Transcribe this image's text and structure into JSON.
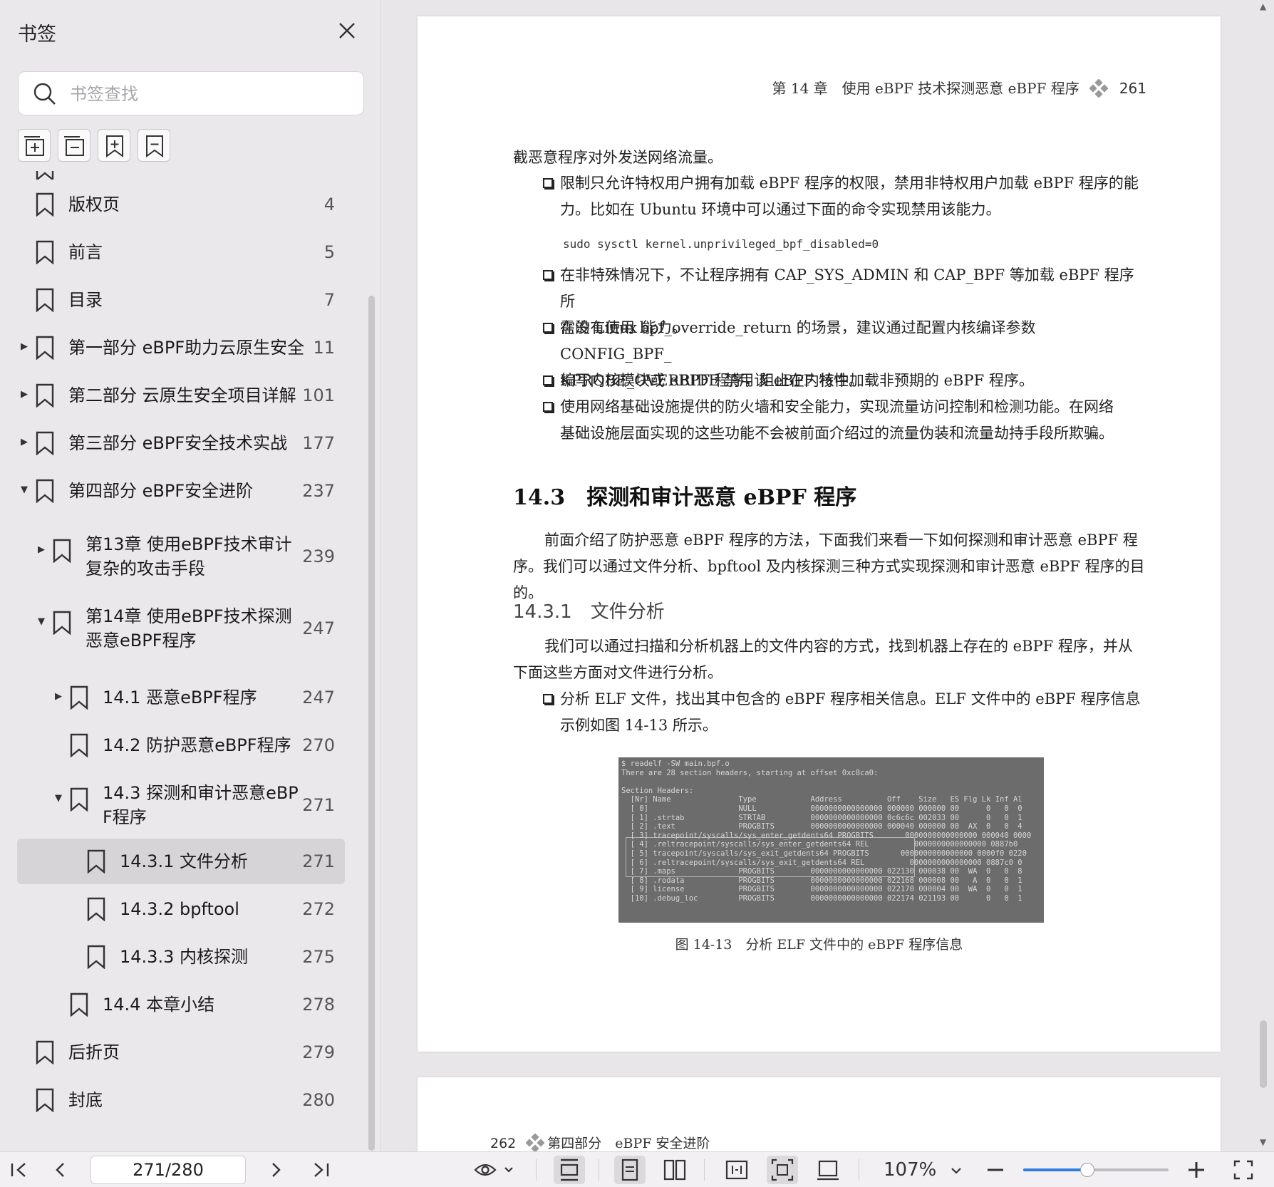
{
  "sidebar": {
    "title": "书签",
    "close_icon": "close-icon",
    "search_placeholder": "书签查找",
    "tools": [
      "expand-all-icon",
      "collapse-all-icon",
      "add-bookmark-icon",
      "remove-bookmark-icon"
    ],
    "items": [
      {
        "label": "版权页",
        "page": "4"
      },
      {
        "label": "前言",
        "page": "5"
      },
      {
        "label": "目录",
        "page": "7"
      },
      {
        "label": "第一部分 eBPF助力云原生安全",
        "page": "11"
      },
      {
        "label": "第二部分 云原生安全项目详解",
        "page": "101"
      },
      {
        "label": "第三部分 eBPF安全技术实战",
        "page": "177"
      },
      {
        "label": "第四部分 eBPF安全进阶",
        "page": "237"
      },
      {
        "label": "第13章 使用eBPF技术审计",
        "label2": "复杂的攻击手段",
        "page": "239"
      },
      {
        "label": "第14章 使用eBPF技术探测",
        "label2": "恶意eBPF程序",
        "page": "247"
      },
      {
        "label": "14.1 恶意eBPF程序",
        "page": "247"
      },
      {
        "label": "14.2 防护恶意eBPF程序",
        "page": "270"
      },
      {
        "label": "14.3 探测和审计恶意eBP",
        "label2": "F程序",
        "page": "271"
      },
      {
        "label": "14.3.1 文件分析",
        "page": "271"
      },
      {
        "label": "14.3.2 bpftool",
        "page": "272"
      },
      {
        "label": "14.3.3 内核探测",
        "page": "275"
      },
      {
        "label": "14.4 本章小结",
        "page": "278"
      },
      {
        "label": "后折页",
        "page": "279"
      },
      {
        "label": "封底",
        "page": "280"
      }
    ]
  },
  "page1": {
    "header_text": "第 14 章　使用 eBPF 技术探测恶意 eBPF 程序",
    "header_page": "261",
    "intro_tail": "截恶意程序对外发送网络流量。",
    "bullet1_l1": "限制只允许特权用户拥有加载 eBPF 程序的权限，禁用非特权用户加载 eBPF 程序的能",
    "bullet1_l2": "力。比如在 Ubuntu 环境中可以通过下面的命令实现禁用该能力。",
    "command": "sudo sysctl kernel.unprivileged_bpf_disabled=0",
    "bullet2_l1": "在非特殊情况下，不让程序拥有 CAP_SYS_ADMIN 和 CAP_BPF 等加载 eBPF 程序所",
    "bullet2_l2": "需的 Linux 能力。",
    "bullet3_l1": "在没有使用 bpf_override_return 的场景，建议通过配置内核编译参数 CONFIG_BPF_",
    "bullet3_l2": "KPROBE_OVERRIDE 禁用该 eBPF 特性。",
    "bullet4_l1": "编写内核模块或 eBPF 程序，阻止在内核中加载非预期的 eBPF 程序。",
    "bullet5_l1": "使用网络基础设施提供的防火墙和安全能力，实现流量访问控制和检测功能。在网络",
    "bullet5_l2": "基础设施层面实现的这些功能不会被前面介绍过的流量伪装和流量劫持手段所欺骗。",
    "section_title": "14.3　探测和审计恶意 eBPF 程序",
    "para1_l1": "前面介绍了防护恶意 eBPF 程序的方法，下面我们来看一下如何探测和审计恶意 eBPF 程",
    "para1_l2": "序。我们可以通过文件分析、bpftool 及内核探测三种方式实现探测和审计恶意 eBPF 程序的目的。",
    "subsection_title": "14.3.1　文件分析",
    "para2_l1": "我们可以通过扫描和分析机器上的文件内容的方式，找到机器上存在的 eBPF 程序，并从",
    "para2_l2": "下面这些方面对文件进行分析。",
    "bullet6_l1": "分析 ELF 文件，找出其中包含的 eBPF 程序相关信息。ELF 文件中的 eBPF 程序信息",
    "bullet6_l2": "示例如图 14-13 所示。",
    "figure_lines": [
      "$ readelf -SW main.bpf.o",
      "There are 28 section headers, starting at offset 0xc8ca0:",
      "",
      "Section Headers:",
      "  [Nr] Name               Type            Address          Off    Size   ES Flg Lk Inf Al",
      "  [ 0]                    NULL            0000000000000000 000000 000000 00      0   0  0",
      "  [ 1] .strtab            STRTAB          0000000000000000 0c6c6c 002033 00      0   0  1",
      "  [ 2] .text              PROGBITS        0000000000000000 000040 000000 00  AX  0   0  4",
      "  [ 3] tracepoint/syscalls/sys_enter_getdents64 PROGBITS       0000000000000000 000040 0000",
      "  [ 4] .reltracepoint/syscalls/sys_enter_getdents64 REL          0000000000000000 0887b0",
      "  [ 5] tracepoint/syscalls/sys_exit_getdents64 PROGBITS       0000000000000000 0000f0 0220",
      "  [ 6] .reltracepoint/syscalls/sys_exit_getdents64 REL          0000000000000000 0887c0 0",
      "  [ 7] .maps              PROGBITS        0000000000000000 022130 000038 00  WA  0   0  8",
      "  [ 8] .rodata            PROGBITS        0000000000000000 022168 000008 00   A  0   0  1",
      "  [ 9] license            PROGBITS        0000000000000000 022170 000004 00  WA  0   0  1",
      "  [10] .debug_loc         PROGBITS        0000000000000000 022174 021193 00      0   0  1"
    ],
    "figure_caption": "图 14-13　分析 ELF 文件中的 eBPF 程序信息"
  },
  "page2": {
    "header_page": "262",
    "header_text": "第四部分　eBPF 安全进阶"
  },
  "toolbar": {
    "page_value": "271/280",
    "zoom": "107%",
    "zoom_level_percent": 44
  }
}
